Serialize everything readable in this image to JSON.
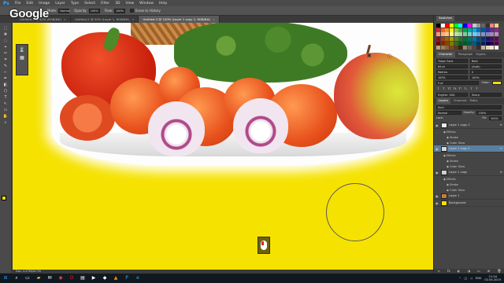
{
  "app": {
    "logo": "Ps"
  },
  "menu": [
    "File",
    "Edit",
    "Image",
    "Layer",
    "Type",
    "Select",
    "Filter",
    "3D",
    "View",
    "Window",
    "Help"
  ],
  "options": {
    "mode_label": "Mode:",
    "mode_value": "Normal",
    "opacity_label": "Opacity:",
    "opacity_value": "100%",
    "flow_label": "Flow:",
    "flow_value": "100%",
    "erase_label": "Erase to History"
  },
  "tabs": [
    {
      "label": "Untitled-1 @ 50% (RGB/8#)",
      "active": false
    },
    {
      "label": "Untitled-2 @ 50% (Layer 1, RGB/8#)",
      "active": false
    },
    {
      "label": "Untitled-3 @ 100% (Layer 1 copy 2, RGB/8#)",
      "active": true
    }
  ],
  "tools": [
    "⬚",
    "✥",
    "◌",
    "⌖",
    "✂",
    "⌗",
    "✎",
    "⌐",
    "✒",
    "◧",
    "⬡",
    "T",
    "↖",
    "▭",
    "✋",
    "⌕"
  ],
  "collapsed_panel": {
    "icons": [
      "history-icon",
      "actions-icon"
    ]
  },
  "canvas_icons": [
    "camera-icon",
    "info-icon"
  ],
  "status": {
    "text": "Doc: 4.47M/26.7M"
  },
  "right_panel": {
    "swatches_tabs": [
      {
        "label": "Swatches",
        "active": true
      },
      {
        "label": "",
        "active": false
      }
    ],
    "swatch_colors": [
      "#000000",
      "#ffffff",
      "#ff0000",
      "#ffff00",
      "#00ff00",
      "#00ffff",
      "#0000ff",
      "#ff00ff",
      "#c8c8c8",
      "#969696",
      "#646464",
      "#323232",
      "#ff8080",
      "#ffd080",
      "#ed1c24",
      "#f26522",
      "#f7941d",
      "#fff200",
      "#8dc63f",
      "#39b54a",
      "#00a651",
      "#00a99d",
      "#00aeef",
      "#0072bc",
      "#0054a6",
      "#2e3192",
      "#662d91",
      "#92278f",
      "#f69679",
      "#f9ad81",
      "#fdc689",
      "#fff799",
      "#c4df9b",
      "#a3d39c",
      "#82ca9d",
      "#7accc8",
      "#6dcff6",
      "#7da7d9",
      "#8393ca",
      "#8781bd",
      "#a186be",
      "#bd8cbf",
      "#9e0b0f",
      "#a0410d",
      "#a36209",
      "#aba000",
      "#598527",
      "#1a7b30",
      "#007236",
      "#00746b",
      "#0076a3",
      "#004b80",
      "#003471",
      "#1b1464",
      "#440e62",
      "#630460",
      "#790000",
      "#7b2e00",
      "#7d4900",
      "#827b00",
      "#406618",
      "#005e20",
      "#005826",
      "#005952",
      "#005b7f",
      "#003663",
      "#002157",
      "#0d004c",
      "#32004b",
      "#4b0049",
      "#c69c6e",
      "#a67c52",
      "#8c6239",
      "#754c24",
      "#603913",
      "#3c2415",
      "#998675",
      "#736357",
      "#534741",
      "#362f2d",
      "#c7b299",
      "#e1d4b8",
      "#f2e6cf",
      "#fff8e8"
    ],
    "character_tabs": [
      "Character",
      "Paragraph",
      "Glyphs"
    ],
    "character": {
      "font": "Trajan Sans",
      "style": "Bold",
      "size": "64 pt",
      "leading": "(Auto)",
      "kerning": "Metrics",
      "tracking": "0",
      "vscale": "100%",
      "hscale": "100%",
      "baseline": "0 pt",
      "color_label": "Color:",
      "color": "#f5e000",
      "type_buttons": [
        "T",
        "T",
        "TT",
        "Tt",
        "T¹",
        "T₁",
        "T",
        "T"
      ],
      "lang": "English: USA",
      "aa": "Sharp"
    },
    "layers_tabs": [
      "Layers",
      "Channels",
      "Paths"
    ],
    "layers_ctrl": {
      "kind_label": "Kind",
      "blend": "Normal",
      "opacity_label": "Opacity:",
      "opacity": "100%",
      "lock_label": "Lock:",
      "fill_label": "Fill:",
      "fill": "100%"
    },
    "layers": [
      {
        "name": "Layer 1 copy 2",
        "active": false,
        "fx": "fx",
        "thumb": "#e8e8e8",
        "effects": [
          "Effects",
          "Stroke",
          "Outer Glow"
        ]
      },
      {
        "name": "Layer 1 copy 2",
        "active": true,
        "fx": "fx",
        "thumb": "#d8d8d8",
        "effects": [
          "Effects",
          "Stroke",
          "Outer Glow"
        ]
      },
      {
        "name": "Layer 1 copy",
        "active": false,
        "fx": "fx",
        "thumb": "#cfcfcf",
        "effects": [
          "Effects",
          "Stroke",
          "Outer Glow"
        ]
      },
      {
        "name": "Layer 1",
        "active": false,
        "fx": "",
        "thumb": "#c77d3a",
        "effects": []
      },
      {
        "name": "Background",
        "active": false,
        "fx": "",
        "thumb": "#f5e000",
        "effects": []
      }
    ],
    "layer_footer": [
      "∞",
      "fx",
      "◐",
      "◑",
      "▭",
      "⊞",
      "🗑"
    ]
  },
  "taskbar": {
    "apps": [
      "start-icon",
      "search-icon",
      "taskview-icon",
      "explorer-icon",
      "mail-icon",
      "chrome-icon",
      "opera-icon",
      "files-icon",
      "media-icon",
      "store-icon",
      "vlc-icon",
      "photoshop-icon",
      "ie-icon"
    ],
    "tray": {
      "lang": "ENG",
      "time": "21:04",
      "date": "02.04.2019"
    }
  },
  "overlay": {
    "watermark": "Google"
  }
}
